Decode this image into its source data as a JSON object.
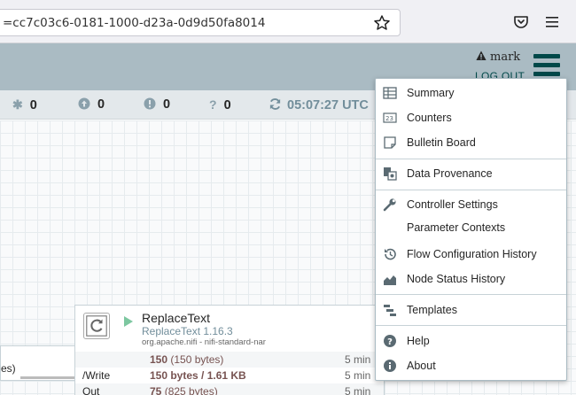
{
  "browser": {
    "url": "=cc7c03c6-0181-1000-d23a-0d9d50fa8014"
  },
  "header": {
    "username": "mark",
    "logout_label": "LOG OUT"
  },
  "status": {
    "items": [
      {
        "icon": "asterisk-icon",
        "value": "0"
      },
      {
        "icon": "arrow-up-circle-icon",
        "value": "0"
      },
      {
        "icon": "exclamation-circle-icon",
        "value": "0"
      },
      {
        "icon": "question-icon",
        "value": "0"
      }
    ],
    "refresh_time": "05:07:27 UTC"
  },
  "processor": {
    "name": "ReplaceText",
    "version": "ReplaceText 1.16.3",
    "bundle": "org.apache.nifi - nifi-standard-nar",
    "rows": [
      {
        "label": "",
        "value": "150",
        "sub": " (150 bytes)",
        "time": "5 min"
      },
      {
        "label": "/Write",
        "value": "150 bytes / 1.61 KB",
        "sub": "",
        "time": "5 min"
      },
      {
        "label": "Out",
        "value": "75",
        "sub": " (825 bytes)",
        "time": "5 min"
      }
    ]
  },
  "queue": {
    "text": "es)"
  },
  "menu": {
    "items": [
      {
        "label": "Summary",
        "icon": "table-icon"
      },
      {
        "label": "Counters",
        "icon": "counter-icon"
      },
      {
        "label": "Bulletin Board",
        "icon": "sticky-note-icon"
      },
      {
        "label": "Data Provenance",
        "icon": "provenance-icon"
      },
      {
        "label": "Controller Settings",
        "icon": "wrench-icon"
      },
      {
        "label": "Parameter Contexts",
        "icon": ""
      },
      {
        "label": "Flow Configuration History",
        "icon": "history-icon"
      },
      {
        "label": "Node Status History",
        "icon": "area-chart-icon"
      },
      {
        "label": "Templates",
        "icon": "templates-icon"
      },
      {
        "label": "Help",
        "icon": "help-circle-icon"
      },
      {
        "label": "About",
        "icon": "info-circle-icon"
      }
    ]
  },
  "colors": {
    "header_bg": "#aabbc3",
    "accent": "#004849",
    "status_bg": "#e3e8eb",
    "run_green": "#7dc7a0"
  }
}
